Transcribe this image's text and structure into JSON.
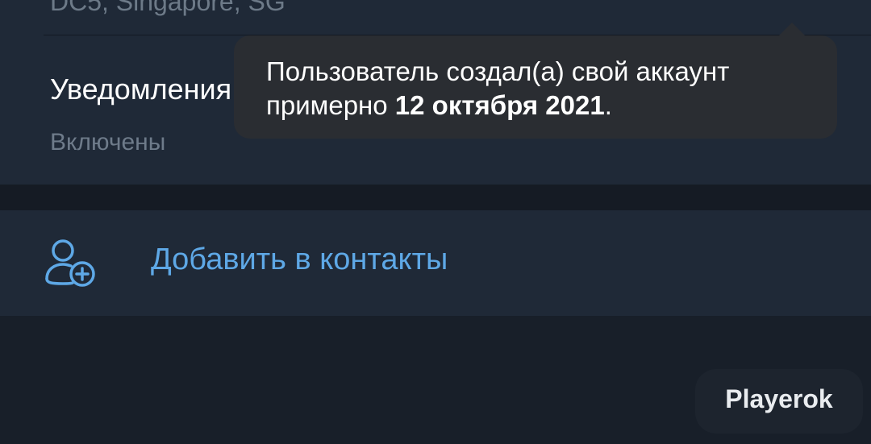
{
  "info": {
    "dc_location": "DC5, Singapore, SG"
  },
  "notifications": {
    "title": "Уведомления",
    "status": "Включены",
    "toggle_on": false
  },
  "add_contact": {
    "icon": "add-user-icon",
    "label": "Добавить в контакты"
  },
  "tooltip": {
    "text_prefix": "Пользователь  создал(а) свой аккаунт примерно ",
    "date": "12 октября 2021",
    "text_suffix": "."
  },
  "watermark": {
    "text": "Playerok"
  },
  "colors": {
    "background": "#181f29",
    "panel": "#1f2937",
    "accent": "#5ea8e6",
    "tooltip": "#2a2d32"
  }
}
